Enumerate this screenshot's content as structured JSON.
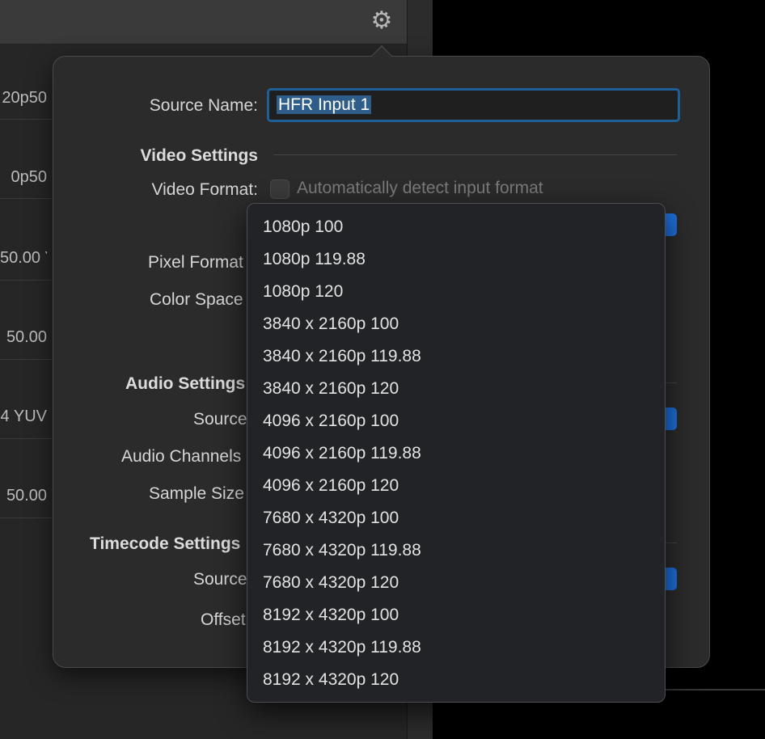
{
  "background": {
    "rows": [
      "20p50",
      "0p50",
      "50.00 Y",
      "50.00",
      "4 YUV",
      "50.00"
    ]
  },
  "popover": {
    "source_name_label": "Source Name:",
    "source_name_value": "HFR Input 1",
    "video_settings": "Video Settings",
    "video_format_label": "Video Format:",
    "auto_detect_label": "Automatically detect input format",
    "pixel_format_label": "Pixel Format",
    "color_space_label": "Color Space",
    "audio_settings": "Audio Settings",
    "audio_source_label": "Source",
    "audio_channels_label": "Audio Channels",
    "sample_size_label": "Sample Size",
    "timecode_settings": "Timecode Settings",
    "timecode_source_label": "Source",
    "offset_label": "Offset"
  },
  "menu": {
    "items": [
      "1080p 100",
      "1080p 119.88",
      "1080p 120",
      "3840 x 2160p 100",
      "3840 x 2160p 119.88",
      "3840 x 2160p 120",
      "4096 x 2160p 100",
      "4096 x 2160p 119.88",
      "4096 x 2160p 120",
      "7680 x 4320p 100",
      "7680 x 4320p 119.88",
      "7680 x 4320p 120",
      "8192 x 4320p 100",
      "8192 x 4320p 119.88",
      "8192 x 4320p 120"
    ]
  },
  "colors": {
    "accent": "#1f6fdc",
    "focus_ring": "#1f5f97"
  },
  "icons": {
    "toolbar": "gear-icon"
  }
}
